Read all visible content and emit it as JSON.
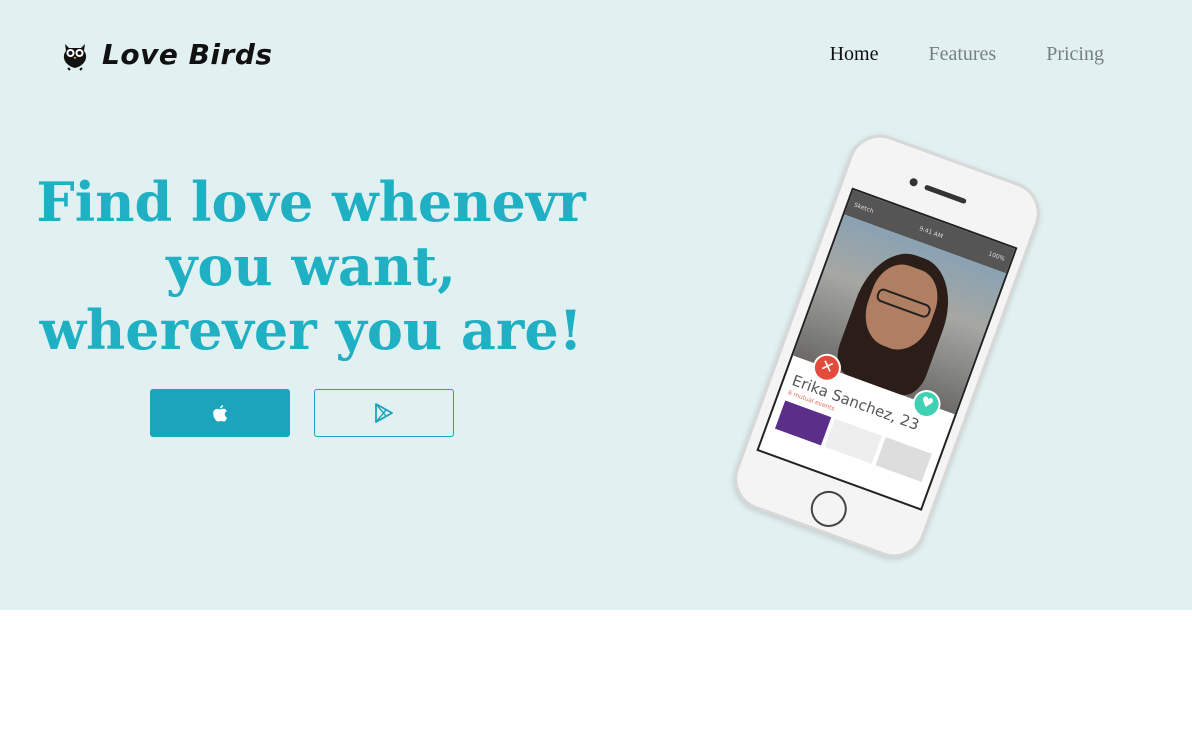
{
  "brand": {
    "name": "Love Birds",
    "logo_icon": "owl-logo-icon"
  },
  "nav": {
    "items": [
      {
        "label": "Home",
        "active": true
      },
      {
        "label": "Features",
        "active": false
      },
      {
        "label": "Pricing",
        "active": false
      }
    ]
  },
  "hero": {
    "headline_lines": [
      "Find love whenevr",
      "you want,",
      "wherever you are!"
    ],
    "buttons": [
      {
        "icon": "apple-icon"
      },
      {
        "icon": "google-play-icon"
      }
    ]
  },
  "phone": {
    "status_carrier": "Sketch",
    "status_time": "9:41 AM",
    "status_battery": "100%",
    "profile_name": "Erika Sanchez, 23",
    "profile_sub": "6 mutual events"
  },
  "colors": {
    "accent": "#1fb1c3",
    "hero_bg": "#e1f0f1"
  }
}
